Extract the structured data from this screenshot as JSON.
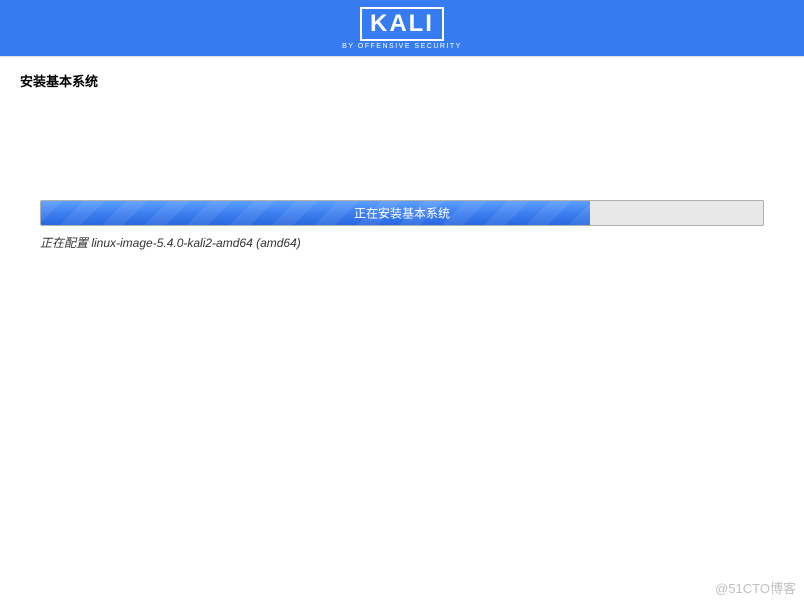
{
  "header": {
    "logo_text": "KALI",
    "logo_subtitle": "BY OFFENSIVE SECURITY"
  },
  "page": {
    "title": "安装基本系统"
  },
  "progress": {
    "label": "正在安装基本系统",
    "percent": 76,
    "status": "正在配置 linux-image-5.4.0-kali2-amd64 (amd64)"
  },
  "watermark": "@51CTO博客"
}
